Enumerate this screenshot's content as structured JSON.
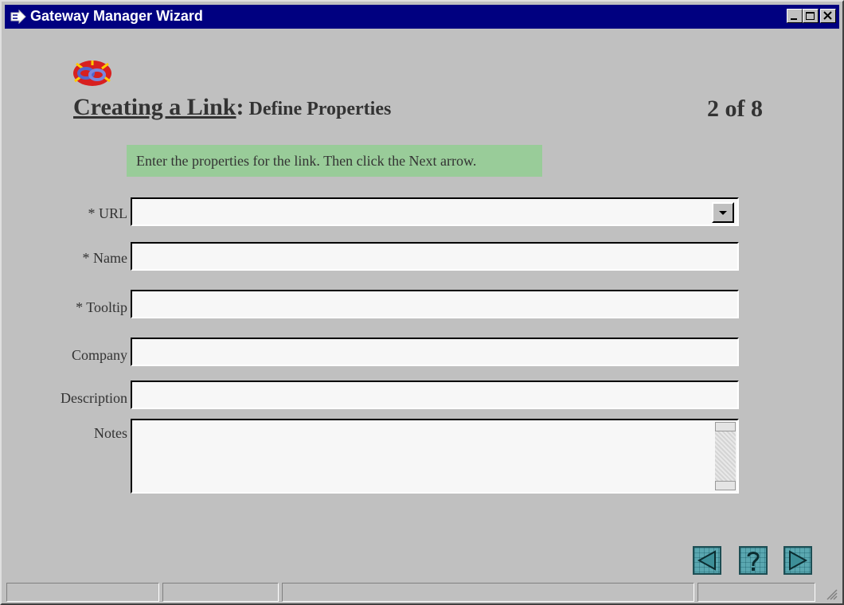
{
  "window": {
    "title": "Gateway Manager Wizard",
    "controls": [
      "minimize",
      "maximize",
      "close"
    ]
  },
  "header": {
    "title_main": "Creating a Link",
    "title_colon": ":",
    "title_sub": "Define Properties",
    "step_indicator": "2 of 8",
    "logo_icon": "chain-link-icon"
  },
  "instructions": "Enter the properties for the link. Then click the Next arrow.",
  "form": {
    "url_label": "* URL",
    "url_value": "",
    "name_label": "* Name",
    "name_value": "",
    "tooltip_label": "* Tooltip",
    "tooltip_value": "",
    "company_label": "Company",
    "company_value": "",
    "description_label": "Description",
    "description_value": "",
    "notes_label": "Notes",
    "notes_value": ""
  },
  "navigation": {
    "back_icon": "left-arrow-icon",
    "help_icon": "question-mark-icon",
    "next_icon": "right-arrow-icon"
  },
  "colors": {
    "titlebar": "#000080",
    "instruction_bg": "#99cc99",
    "nav_button": "#5aa7b0",
    "window_bg": "#c0c0c0"
  }
}
